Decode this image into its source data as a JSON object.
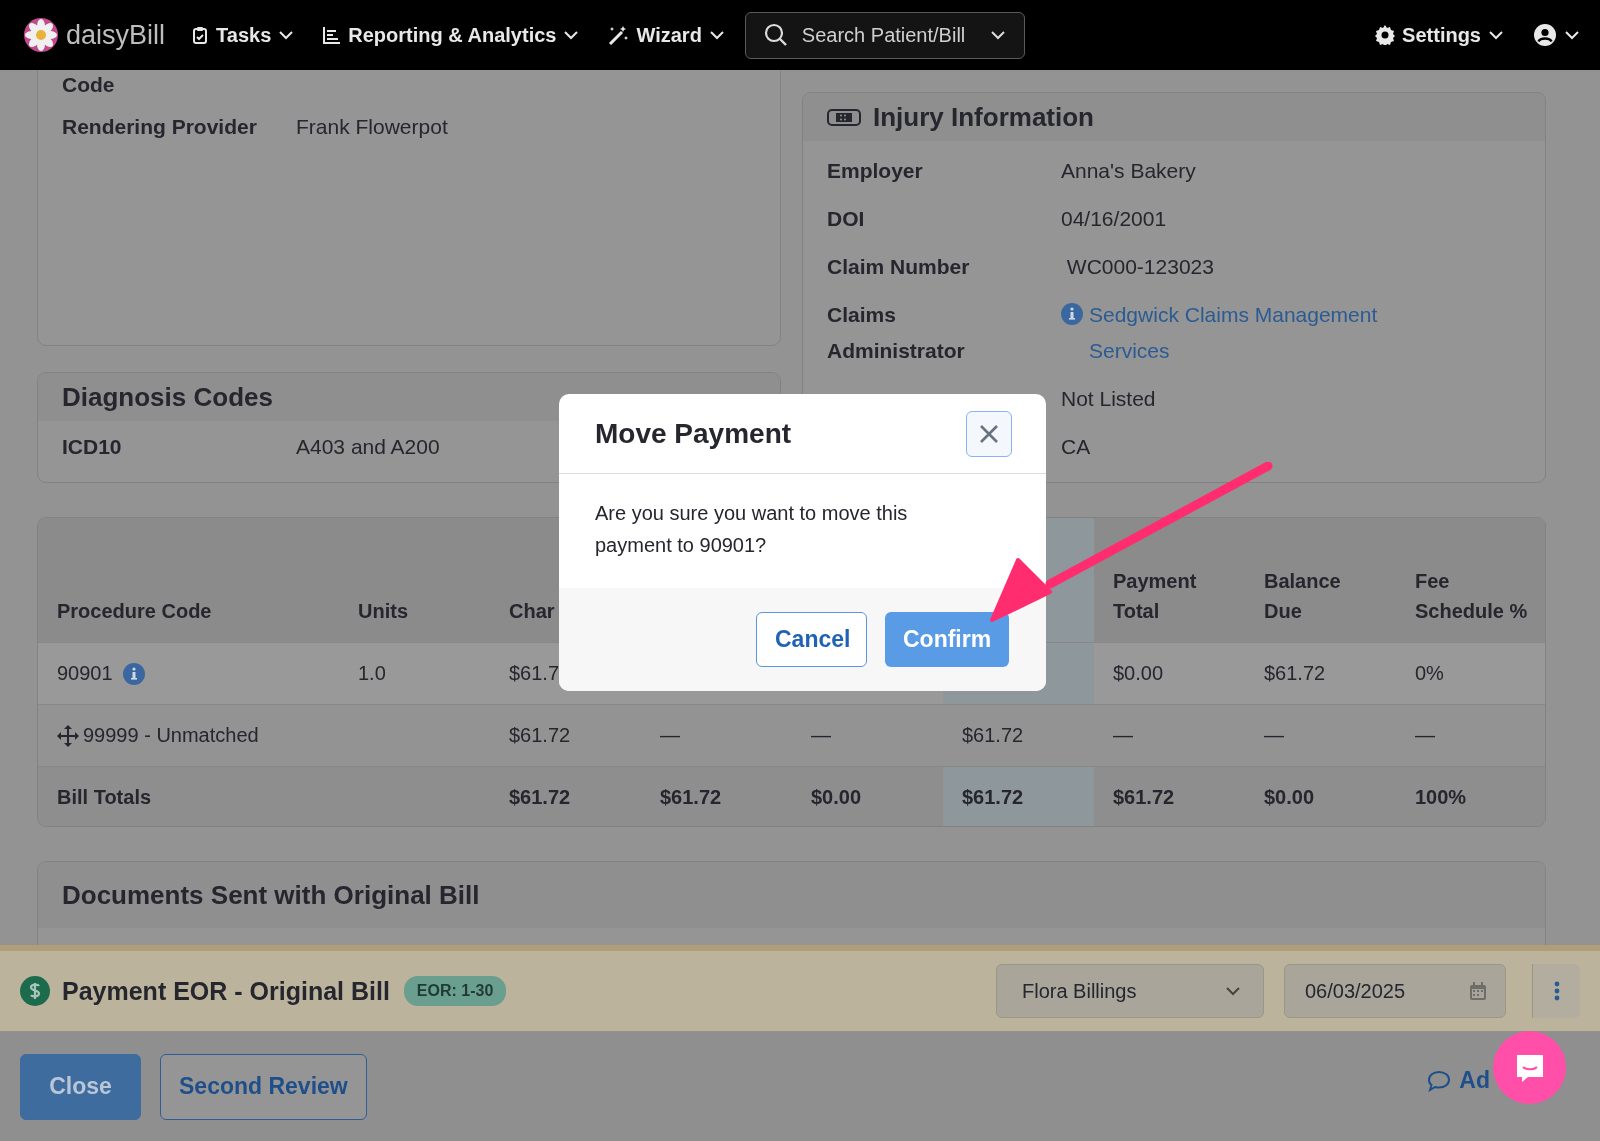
{
  "nav": {
    "logo": "daisyBill",
    "menus": [
      {
        "label": "Tasks"
      },
      {
        "label": "Reporting & Analytics"
      },
      {
        "label": "Wizard"
      }
    ],
    "search": {
      "placeholder": "Search Patient/Bill"
    },
    "settings": "Settings"
  },
  "provider_card": {
    "rows": [
      {
        "label": "Code"
      },
      {
        "label": "Rendering Provider",
        "value": "Frank Flowerpot"
      }
    ]
  },
  "diagnosis_card": {
    "title": "Diagnosis Codes",
    "rows": [
      {
        "label": "ICD10",
        "value": "A403 and A200"
      }
    ]
  },
  "injury_card": {
    "title": "Injury Information",
    "rows": [
      {
        "label": "Employer",
        "value": "Anna's Bakery"
      },
      {
        "label": "DOI",
        "value": "04/16/2001"
      },
      {
        "label": "Claim Number",
        "value": " WC000-123023"
      },
      {
        "label": "Claims Administrator",
        "value": "Sedgwick Claims Management Services",
        "link": true
      },
      {
        "value": "Not Listed"
      },
      {
        "value": "CA"
      }
    ]
  },
  "table": {
    "columns": [
      {
        "label": "Procedure Code",
        "highlighted": false
      },
      {
        "label": "Units",
        "highlighted": false
      },
      {
        "label": "Char",
        "highlighted": false
      },
      {
        "highlighted": false
      },
      {
        "highlighted": false
      },
      {
        "highlighted": true
      },
      {
        "label": "Payment Total",
        "highlighted": false
      },
      {
        "label": "Balance Due",
        "highlighted": false
      },
      {
        "label": "Fee Schedule %",
        "highlighted": false
      }
    ],
    "rows": [
      {
        "kind": "matched",
        "cells": [
          "90901",
          "1.0",
          "$61.7",
          null,
          null,
          null,
          "$0.00",
          "$61.72",
          "0%"
        ]
      },
      {
        "kind": "unmatched",
        "cells": [
          "99999 - Unmatched",
          null,
          "$61.72",
          "—",
          "—",
          "$61.72",
          "—",
          "—",
          "—"
        ]
      },
      {
        "kind": "total",
        "cells": [
          "Bill Totals",
          null,
          "$61.72",
          "$61.72",
          "$0.00",
          "$61.72",
          "$61.72",
          "$0.00",
          "100%"
        ]
      }
    ]
  },
  "documents_card": {
    "title": "Documents Sent with Original Bill"
  },
  "payment_bar": {
    "title": "Payment EOR - Original Bill",
    "badge": "EOR: 1-30",
    "payer": "Flora Billings",
    "date": "06/03/2025"
  },
  "footer": {
    "buttons": [
      {
        "label": "Close",
        "kind": "primary"
      },
      {
        "label": "Second Review",
        "kind": "outline"
      }
    ],
    "link": "Ad"
  },
  "modal": {
    "title": "Move Payment",
    "message": "Are you sure you want to move this payment to 90901?",
    "buttons": [
      {
        "label": "Cancel",
        "kind": "outline"
      },
      {
        "label": "Confirm",
        "kind": "primary"
      }
    ]
  }
}
